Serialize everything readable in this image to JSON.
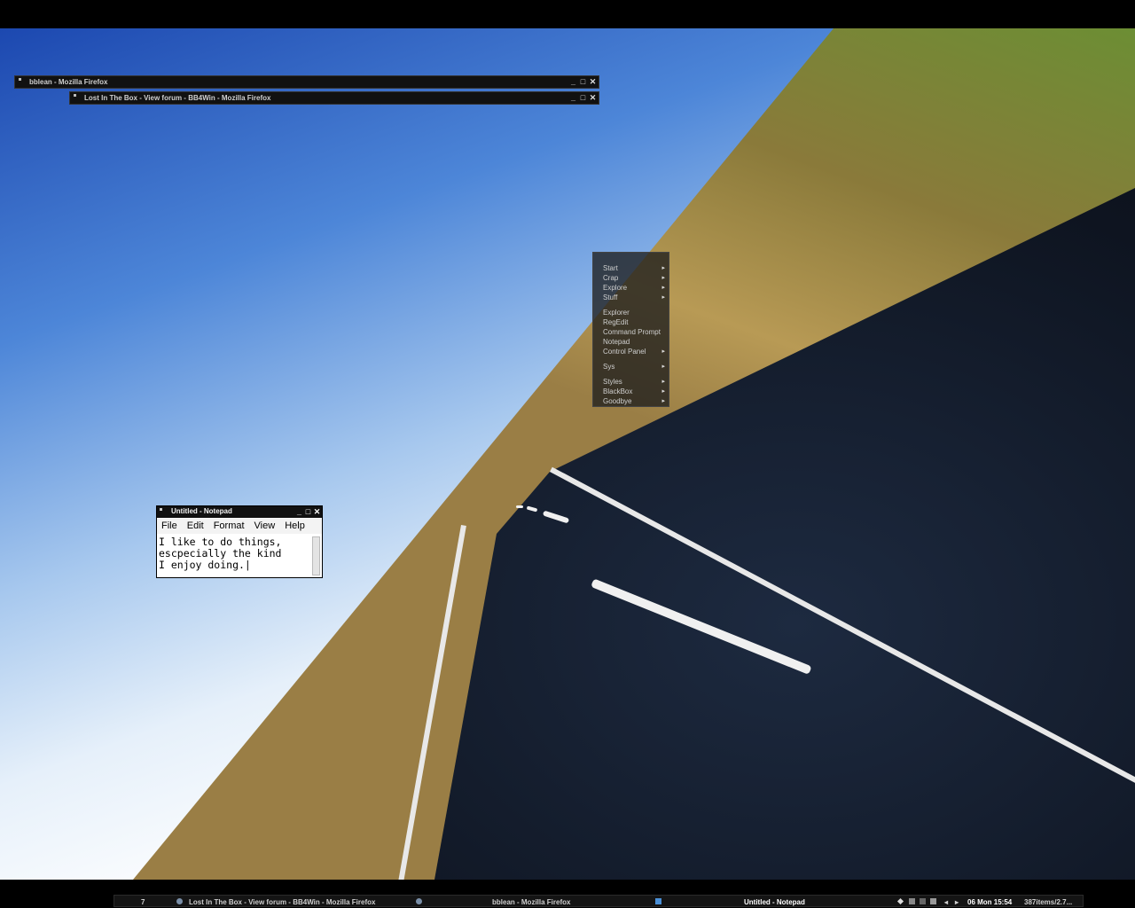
{
  "windows": [
    {
      "title": "bblean - Mozilla Firefox"
    },
    {
      "title": "Lost In The Box - View forum - BB4Win - Mozilla Firefox"
    }
  ],
  "window_controls": {
    "minimize": "_",
    "maximize": "□",
    "close": "✕"
  },
  "menu": {
    "items": [
      {
        "label": "Start",
        "submenu": true
      },
      {
        "label": "Crap",
        "submenu": true
      },
      {
        "label": "Explore",
        "submenu": true
      },
      {
        "label": "Stuff",
        "submenu": true
      },
      {
        "label": "Explorer",
        "submenu": false
      },
      {
        "label": "RegEdit",
        "submenu": false
      },
      {
        "label": "Command Prompt",
        "submenu": false
      },
      {
        "label": "Notepad",
        "submenu": false
      },
      {
        "label": "Control Panel",
        "submenu": true
      },
      {
        "label": "Sys",
        "submenu": true
      },
      {
        "label": "Styles",
        "submenu": true
      },
      {
        "label": "BlackBox",
        "submenu": true
      },
      {
        "label": "Goodbye",
        "submenu": true
      }
    ],
    "arrow": "▸"
  },
  "notepad": {
    "title": "Untitled - Notepad",
    "menubar": [
      "File",
      "Edit",
      "Format",
      "View",
      "Help"
    ],
    "content": "I like to do things,\nescpecially the kind\nI enjoy doing.|"
  },
  "taskbar": {
    "workspace": "7",
    "tasks": [
      "Lost In The Box - View forum - BB4Win - Mozilla Firefox",
      "bblean - Mozilla Firefox",
      "Untitled - Notepad"
    ],
    "clock": "06 Mon 15:54",
    "status": "387items/2.7...",
    "prev": "◂",
    "next": "▸"
  },
  "colors": {
    "sky_blue": "#2552b8",
    "window_bar": "#111111",
    "road": "#0e1420"
  }
}
